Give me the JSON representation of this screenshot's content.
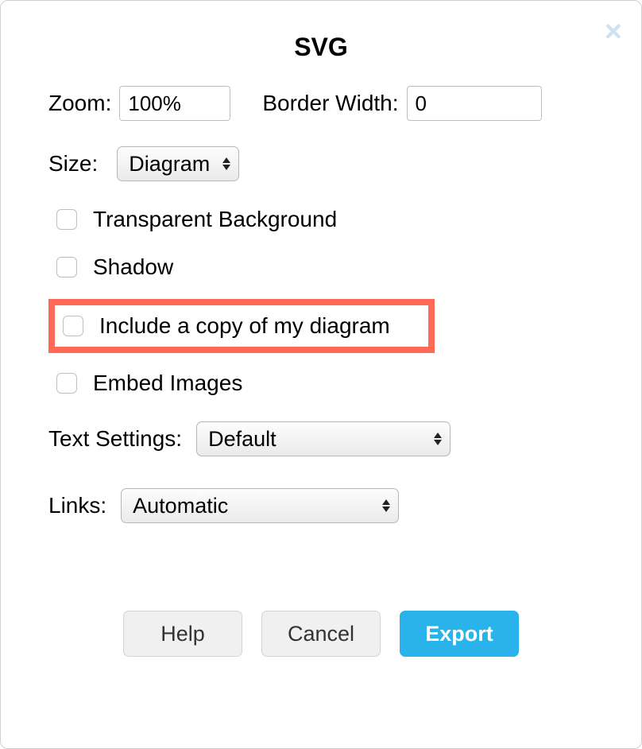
{
  "title": "SVG",
  "zoom": {
    "label": "Zoom:",
    "value": "100%"
  },
  "border_width": {
    "label": "Border Width:",
    "value": "0"
  },
  "size": {
    "label": "Size:",
    "value": "Diagram"
  },
  "checkboxes": {
    "transparent_bg": "Transparent Background",
    "shadow": "Shadow",
    "include_copy": "Include a copy of my diagram",
    "embed_images": "Embed Images"
  },
  "text_settings": {
    "label": "Text Settings:",
    "value": "Default"
  },
  "links": {
    "label": "Links:",
    "value": "Automatic"
  },
  "buttons": {
    "help": "Help",
    "cancel": "Cancel",
    "export": "Export"
  }
}
